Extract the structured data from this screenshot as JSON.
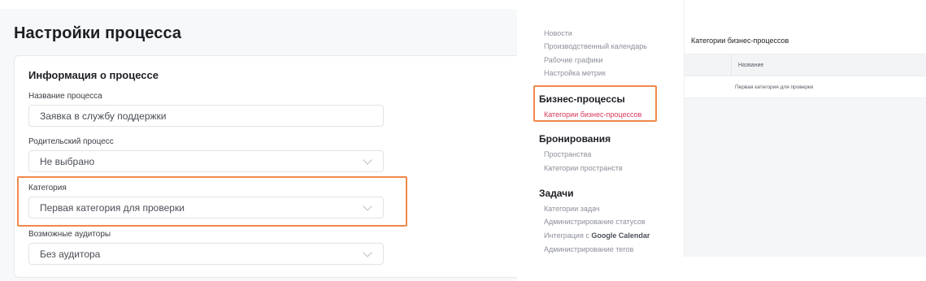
{
  "process_settings": {
    "page_title": "Настройки процесса",
    "card_title": "Информация о процессе",
    "fields": {
      "name": {
        "label": "Название процесса",
        "value": "Заявка в службу поддержки"
      },
      "parent": {
        "label": "Родительский процесс",
        "value": "Не выбрано"
      },
      "category": {
        "label": "Категория",
        "value": "Первая категория для проверки"
      },
      "auditors": {
        "label": "Возможные аудиторы",
        "value": "Без аудитора"
      }
    }
  },
  "sidebar": {
    "items_top": [
      "Новости",
      "Производственный календарь",
      "Рабочие графики",
      "Настройка метрик"
    ],
    "sections": [
      {
        "title": "Бизнес-процессы",
        "items": [
          "Категории бизнес-процессов"
        ]
      },
      {
        "title": "Бронирования",
        "items": [
          "Пространства",
          "Категории пространств"
        ]
      },
      {
        "title": "Задачи",
        "items": [
          "Категории задач",
          "Администрирование статусов",
          "Интеграция с ",
          "Администрирование тегов"
        ]
      }
    ],
    "integration_brand": "Google Calendar",
    "active_item": "Категории бизнес-процессов"
  },
  "categories_table": {
    "title": "Категории бизнес-процессов",
    "columns": [
      "Название"
    ],
    "rows": [
      [
        "Первая категория для проверки"
      ]
    ]
  },
  "colors": {
    "highlight": "#f0894a",
    "active_link": "#d9365b"
  }
}
